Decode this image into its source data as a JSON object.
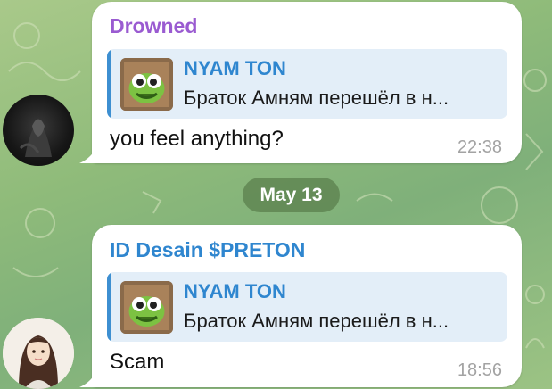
{
  "messages": [
    {
      "sender": "Drowned",
      "sender_color": "#9a5bd1",
      "reply": {
        "title": "NYAM TON",
        "text": "Браток Амням перешёл в н..."
      },
      "text": "you feel anything?",
      "time": "22:38"
    },
    {
      "sender": "ID Desain $PRETON",
      "sender_color": "#2f86cf",
      "reply": {
        "title": "NYAM TON",
        "text": "Браток Амням перешёл в н..."
      },
      "text": "Scam",
      "time": "18:56"
    }
  ],
  "date_separator": "May 13",
  "colors": {
    "reply_accent": "#3d8fd1",
    "bubble_bg": "#ffffff"
  }
}
